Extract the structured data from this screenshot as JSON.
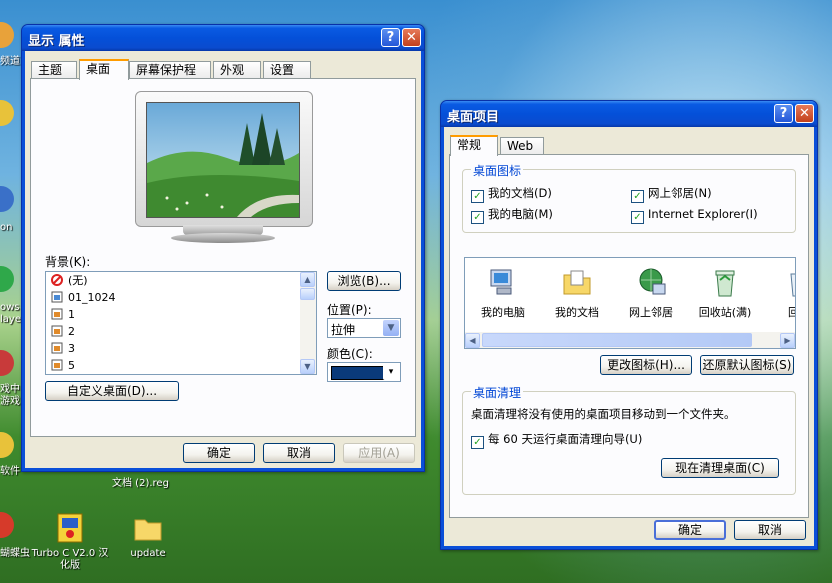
{
  "desktop": {
    "left_edge_labels": [
      "频道",
      "on",
      "ows",
      "laye",
      "戏中",
      "游戏",
      "软件",
      "蝴蝶虫"
    ],
    "icons": [
      {
        "label": "Turbo C V2.0 汉化版"
      },
      {
        "label": "update"
      }
    ],
    "partial_labels": [
      "文档 (2).reg"
    ]
  },
  "display_window": {
    "title": "显示 属性",
    "tabs": [
      "主题",
      "桌面",
      "屏幕保护程序",
      "外观",
      "设置"
    ],
    "active_tab": "桌面",
    "background_label": "背景(K):",
    "background_items": [
      "(无)",
      "01_1024",
      "1",
      "2",
      "3",
      "5"
    ],
    "browse_button": "浏览(B)...",
    "position_label": "位置(P):",
    "position_value": "拉伸",
    "color_label": "颜色(C):",
    "color_value": "#0a3a7a",
    "customize_button": "自定义桌面(D)...",
    "ok": "确定",
    "cancel": "取消",
    "apply": "应用(A)"
  },
  "items_window": {
    "title": "桌面项目",
    "tabs": [
      "常规",
      "Web"
    ],
    "icons_group": "桌面图标",
    "checkboxes": [
      {
        "label": "我的文档(D)",
        "checked": true
      },
      {
        "label": "网上邻居(N)",
        "checked": true
      },
      {
        "label": "我的电脑(M)",
        "checked": true
      },
      {
        "label": "Internet Explorer(I)",
        "checked": true
      }
    ],
    "pane_items": [
      "我的电脑",
      "我的文档",
      "网上邻居",
      "回收站(满)",
      "回收"
    ],
    "change_icon_button": "更改图标(H)...",
    "restore_default_button": "还原默认图标(S)",
    "cleanup_group": "桌面清理",
    "cleanup_text": "桌面清理将没有使用的桌面项目移动到一个文件夹。",
    "cleanup_checkbox": "每 60 天运行桌面清理向导(U)",
    "cleanup_now_button": "现在清理桌面(C)",
    "ok": "确定",
    "cancel": "取消"
  }
}
